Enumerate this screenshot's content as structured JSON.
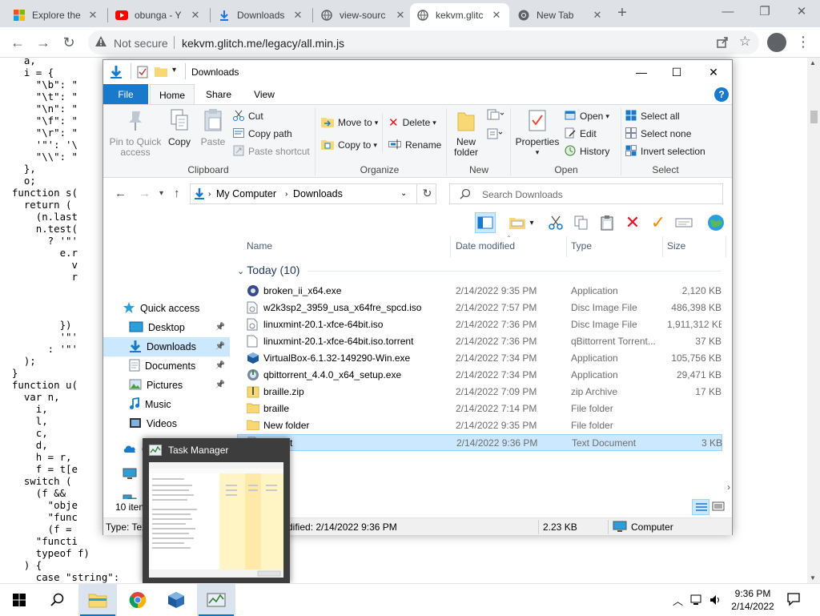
{
  "browser": {
    "tabs": [
      {
        "title": "Explore the",
        "icon": "windows-icon",
        "active": false
      },
      {
        "title": "obunga - Y",
        "icon": "youtube-icon",
        "active": false
      },
      {
        "title": "Downloads",
        "icon": "download-icon",
        "active": false
      },
      {
        "title": "view-sourc",
        "icon": "globe-icon",
        "active": false
      },
      {
        "title": "kekvm.glitc",
        "icon": "globe-icon",
        "active": true
      },
      {
        "title": "New Tab",
        "icon": "chrome-icon",
        "active": false
      }
    ],
    "new_tab_label": "+",
    "address": {
      "security": "Not secure",
      "url": "kekvm.glitch.me/legacy/all.min.js"
    }
  },
  "code_lines": [
    "    a,",
    "    i = {",
    "      \"\\b\": \"",
    "      \"\\t\": \"",
    "      \"\\n\": \"",
    "      \"\\f\": \"",
    "      \"\\r\": \"",
    "      '\"': '\\",
    "      \"\\\\\": \"",
    "    },",
    "    o;",
    "  function s(",
    "    return (",
    "      (n.last",
    "      n.test(",
    "        ? '\"'",
    "          e.r",
    "            v",
    "            r",
    "",
    "",
    "",
    "          })",
    "          '\"'",
    "        : '\"'",
    "    );",
    "  }",
    "  function u(",
    "    var n,",
    "      i,",
    "      l,",
    "      c,",
    "      d,",
    "      h = r,",
    "      f = t[e",
    "    switch (",
    "      (f &&",
    "        \"obje",
    "        \"func",
    "        (f =",
    "      \"functi",
    "      typeof f)",
    "    ) {",
    "      case \"string\":",
    "        return s(f);"
  ],
  "explorer": {
    "title": "Downloads",
    "window_controls": {
      "minimize": "—",
      "maximize": "☐",
      "close": "✕"
    },
    "ribbon_tabs": [
      "File",
      "Home",
      "Share",
      "View"
    ],
    "help": "?",
    "clipboard": {
      "pin": "Pin to Quick access",
      "copy": "Copy",
      "paste": "Paste",
      "cut": "Cut",
      "copy_path": "Copy path",
      "paste_shortcut": "Paste shortcut",
      "group": "Clipboard"
    },
    "organize": {
      "move_to": "Move to",
      "copy_to": "Copy to",
      "delete": "Delete",
      "rename": "Rename",
      "group": "Organize"
    },
    "new": {
      "new_folder": "New folder",
      "group": "New"
    },
    "open": {
      "properties": "Properties",
      "open": "Open",
      "edit": "Edit",
      "history": "History",
      "group": "Open"
    },
    "select": {
      "select_all": "Select all",
      "select_none": "Select none",
      "invert_selection": "Invert selection",
      "group": "Select"
    },
    "breadcrumb": [
      "My Computer",
      "Downloads"
    ],
    "search_placeholder": "Search Downloads",
    "nav": [
      {
        "label": "Quick access",
        "icon": "star-icon",
        "pinned": false,
        "selected": false
      },
      {
        "label": "Desktop",
        "icon": "desktop-icon",
        "pinned": true,
        "selected": false
      },
      {
        "label": "Downloads",
        "icon": "download-icon",
        "pinned": true,
        "selected": true
      },
      {
        "label": "Documents",
        "icon": "document-icon",
        "pinned": true,
        "selected": false
      },
      {
        "label": "Pictures",
        "icon": "picture-icon",
        "pinned": true,
        "selected": false
      },
      {
        "label": "Music",
        "icon": "music-icon",
        "pinned": false,
        "selected": false
      },
      {
        "label": "Videos",
        "icon": "video-icon",
        "pinned": false,
        "selected": false
      },
      {
        "label": "OneDrive",
        "icon": "cloud-icon",
        "pinned": false,
        "selected": false
      },
      {
        "label": "My Computer",
        "icon": "computer-icon",
        "pinned": false,
        "selected": false
      },
      {
        "label": "Ne",
        "icon": "network-icon",
        "pinned": false,
        "selected": false
      }
    ],
    "columns": [
      "Name",
      "Date modified",
      "Type",
      "Size"
    ],
    "group_header": "Today (10)",
    "files": [
      {
        "name": "broken_ii_x64.exe",
        "date": "2/14/2022 9:35 PM",
        "type": "Application",
        "size": "2,120 KB",
        "icon": "app-icon",
        "selected": false
      },
      {
        "name": "w2k3sp2_3959_usa_x64fre_spcd.iso",
        "date": "2/14/2022 7:57 PM",
        "type": "Disc Image File",
        "size": "486,398 KB",
        "icon": "disc-file-icon",
        "selected": false
      },
      {
        "name": "linuxmint-20.1-xfce-64bit.iso",
        "date": "2/14/2022 7:36 PM",
        "type": "Disc Image File",
        "size": "1,911,312 KB",
        "icon": "disc-file-icon",
        "selected": false
      },
      {
        "name": "linuxmint-20.1-xfce-64bit.iso.torrent",
        "date": "2/14/2022 7:36 PM",
        "type": "qBittorrent Torrent...",
        "size": "37 KB",
        "icon": "file-icon",
        "selected": false
      },
      {
        "name": "VirtualBox-6.1.32-149290-Win.exe",
        "date": "2/14/2022 7:34 PM",
        "type": "Application",
        "size": "105,756 KB",
        "icon": "virtualbox-icon",
        "selected": false
      },
      {
        "name": "qbittorrent_4.4.0_x64_setup.exe",
        "date": "2/14/2022 7:34 PM",
        "type": "Application",
        "size": "29,471 KB",
        "icon": "installer-icon",
        "selected": false
      },
      {
        "name": "braille.zip",
        "date": "2/14/2022 7:09 PM",
        "type": "zip Archive",
        "size": "17 KB",
        "icon": "zip-icon",
        "selected": false
      },
      {
        "name": "braille",
        "date": "2/14/2022 7:14 PM",
        "type": "File folder",
        "size": "",
        "icon": "folder-icon",
        "selected": false
      },
      {
        "name": "New folder",
        "date": "2/14/2022 9:35 PM",
        "type": "File folder",
        "size": "",
        "icon": "folder-icon",
        "selected": false
      },
      {
        "name": "test.txt",
        "date": "2/14/2022 9:36 PM",
        "type": "Text Document",
        "size": "3 KB",
        "icon": "text-file-icon",
        "selected": true
      }
    ],
    "status": {
      "items": "10 item",
      "type_prefix": "Type: Tex",
      "modified": "dified: 2/14/2022 9:36 PM",
      "size": "2.23 KB",
      "location": "Computer"
    }
  },
  "task_manager_thumb": {
    "title": "Task Manager"
  },
  "taskbar": {
    "apps": [
      {
        "name": "file-explorer-icon",
        "active": true
      },
      {
        "name": "chrome-icon",
        "active": false
      },
      {
        "name": "virtualbox-icon",
        "active": false
      },
      {
        "name": "task-manager-icon",
        "active": true
      }
    ],
    "time": "9:36 PM",
    "date": "2/14/2022"
  },
  "colors": {
    "accent": "#1979ca",
    "selection": "#cce8ff",
    "delete_red": "#e81123",
    "check_orange": "#f08c00"
  }
}
